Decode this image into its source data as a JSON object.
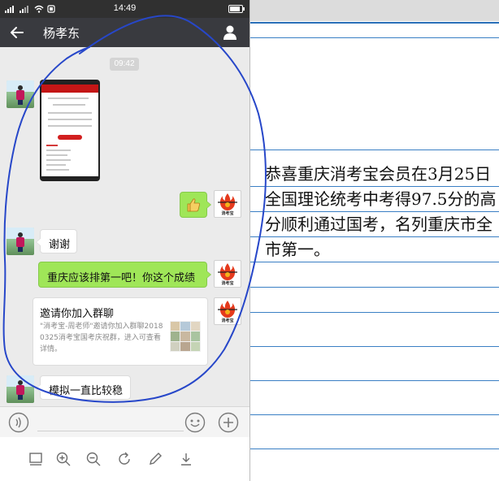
{
  "status_bar": {
    "time": "14:49"
  },
  "chat": {
    "title": "杨孝东",
    "timestamp": "09:42",
    "messages": {
      "thanks": "谢谢",
      "reply": "重庆应该排第一吧！你这个成绩",
      "last": "模拟一直比较稳"
    },
    "thumbs_up_icon": "thumbs-up-icon",
    "invite": {
      "title": "邀请你加入群聊",
      "desc": "\"消考宝-周老师\"邀请你加入群聊20180325消考宝国考庆祝群，进入可查看详情。"
    },
    "sender_avatar_text": "消考宝"
  },
  "notebook": {
    "text": "恭喜重庆消考宝会员在3月25日全国理论统考中考得97.5分的高分顺利通过国考，名列重庆市全市第一。"
  },
  "colors": {
    "titlebar": "#393a3f",
    "bubble_green": "#9fe658",
    "loop_blue": "#2747c9",
    "ruled_line": "#3a7fc4"
  },
  "icons": {
    "viewer_tools": [
      "gallery-icon",
      "zoom-in-icon",
      "zoom-out-icon",
      "rotate-icon",
      "edit-icon",
      "download-icon"
    ]
  }
}
